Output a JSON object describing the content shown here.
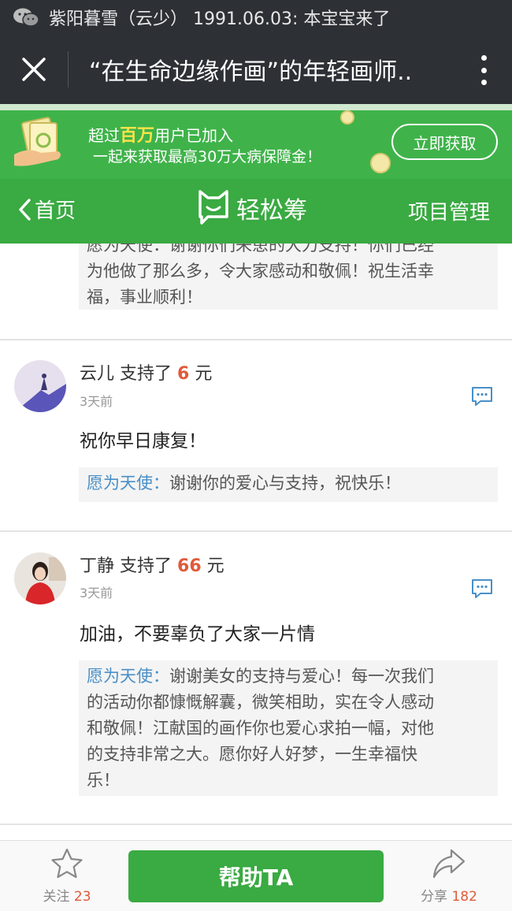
{
  "status_bar": {
    "notice": "紫阳暮雪（云少） 1991.06.03: 本宝宝来了"
  },
  "title_bar": {
    "title": "“在生命边缘作画”的年轻画师..."
  },
  "banner": {
    "line1_prefix": "超过",
    "line1_highlight": "百万",
    "line1_suffix": "用户已加入",
    "line2": "一起来获取最高30万大病保障金！",
    "cta_label": "立即获取"
  },
  "nav": {
    "back_label": "首页",
    "brand": "轻松筹",
    "manage_label": "项目管理"
  },
  "comments": {
    "partial_reply": {
      "line1": "愿为天使：谢谢你们来患的大力支持！你们已经",
      "line2": "为他做了那么多，令大家感动和敬佩！祝生活幸",
      "line3": "福，事业顺利！"
    },
    "items": [
      {
        "name": "云儿",
        "supported": "支持了",
        "amount": "6",
        "unit": "元",
        "time": "3天前",
        "message": "祝你早日康复！",
        "reply_who": "愿为天使：",
        "reply_lines": [
          "谢谢你的爱心与支持，祝快乐！"
        ]
      },
      {
        "name": "丁静",
        "supported": "支持了",
        "amount": "66",
        "unit": "元",
        "time": "3天前",
        "message": "加油，不要辜负了大家一片情",
        "reply_who": "愿为天使：",
        "reply_lines": [
          "谢谢美女的支持与爱心！每一次我们",
          "的活动你都慷慨解囊，微笑相助，实在令人感动",
          "和敬佩！江献国的画作你也爱心求拍一幅，对他",
          "的支持非常之大。愿你好人好梦，一生幸福快",
          "乐！"
        ]
      }
    ]
  },
  "bottom_bar": {
    "follow_label": "关注",
    "follow_count": "23",
    "help_label": "帮助TA",
    "share_label": "分享",
    "share_count": "182"
  },
  "colors": {
    "accent_green": "#3aaa42",
    "amount_red": "#e05a3a",
    "reply_blue": "#4a8fc7",
    "dark_bar": "#2d3035"
  }
}
